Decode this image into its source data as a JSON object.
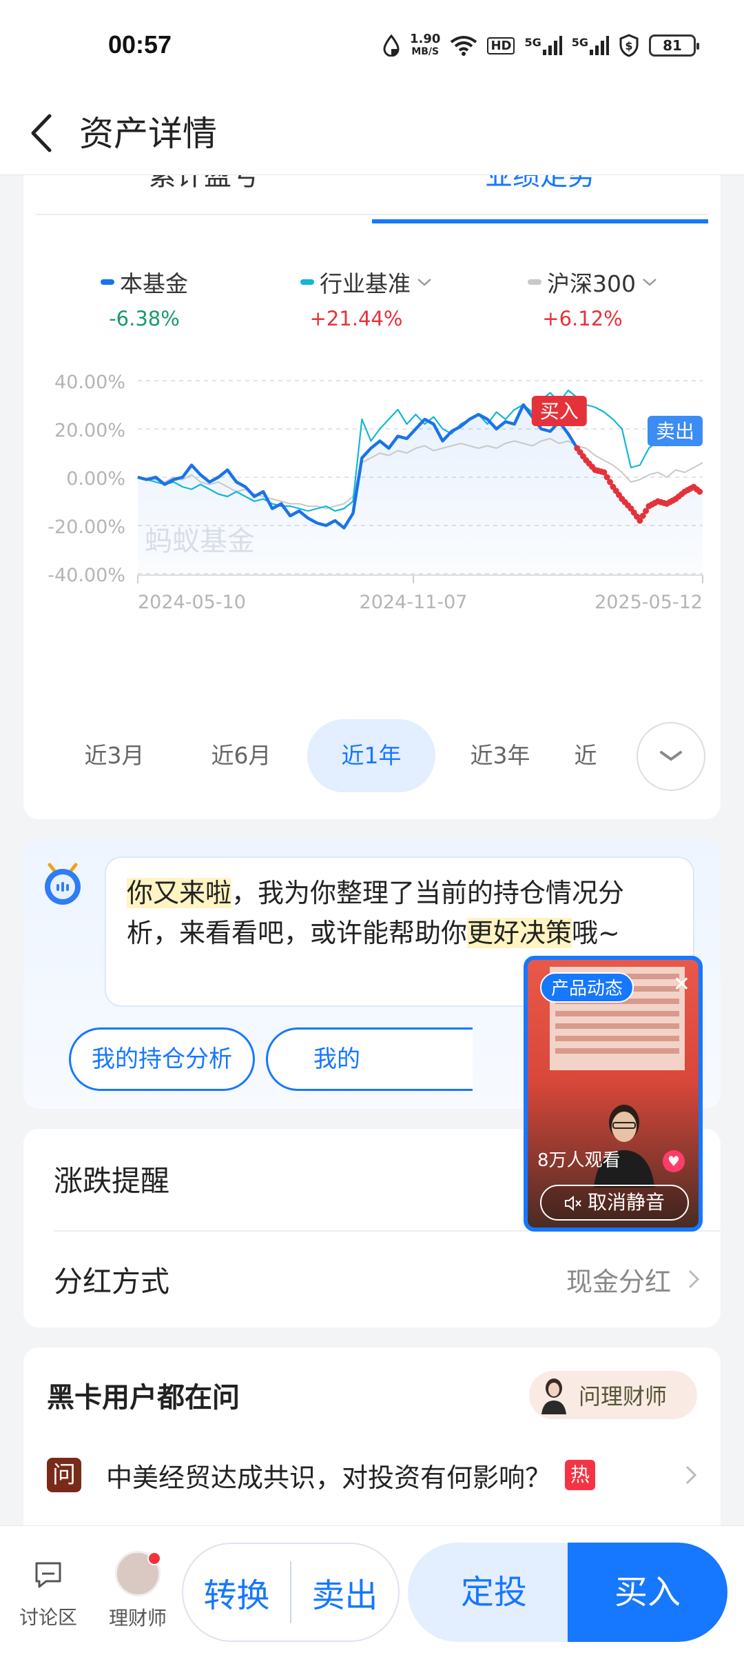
{
  "status_bar": {
    "time": "00:57",
    "net_speed": "1.90",
    "net_unit": "MB/S",
    "hd_label": "HD",
    "sim1": "5G",
    "sim2": "5G",
    "battery": "81"
  },
  "header": {
    "title": "资产详情"
  },
  "tabs": [
    {
      "label": "累计盈亏",
      "active": false
    },
    {
      "label": "业绩走势",
      "active": true
    }
  ],
  "legend": [
    {
      "name": "本基金",
      "value": "-6.38%",
      "color": "#1a73e8",
      "value_color": "#1a9a6a"
    },
    {
      "name": "行业基准",
      "value": "+21.44%",
      "color": "#12b6d6",
      "value_color": "#e5323a"
    },
    {
      "name": "沪深300",
      "value": "+6.12%",
      "color": "#c8c8c8",
      "value_color": "#e5323a"
    }
  ],
  "chart_data": {
    "type": "line",
    "y_ticks": [
      "40.00%",
      "20.00%",
      "0.00%",
      "-20.00%",
      "-40.00%"
    ],
    "ylim": [
      -40,
      40
    ],
    "x_tick_labels": [
      "2024-05-10",
      "2024-11-07",
      "2025-05-12"
    ],
    "watermark": "蚂蚁基金",
    "series": [
      {
        "name": "本基金",
        "color": "#1a73e8",
        "values": [
          0,
          -1,
          0,
          -3,
          -1,
          0,
          5,
          1,
          -2,
          0,
          3,
          -2,
          -4,
          -8,
          -6,
          -13,
          -11,
          -16,
          -14,
          -17,
          -19,
          -20,
          -18,
          -21,
          -15,
          8,
          12,
          15,
          12,
          17,
          16,
          20,
          24,
          22,
          15,
          19,
          21,
          24,
          26,
          24,
          20,
          23,
          22,
          30,
          25,
          20,
          19,
          23,
          18,
          12,
          7,
          3,
          2,
          -4,
          -9,
          -13,
          -18,
          -12,
          -10,
          -11,
          -9,
          -6,
          -4,
          -7
        ]
      },
      {
        "name": "行业基准",
        "color": "#12b6d6",
        "values": [
          0,
          -1,
          -2,
          -3,
          -2,
          -4,
          -5,
          -3,
          -5,
          -7,
          -8,
          -6,
          -8,
          -10,
          -9,
          -11,
          -12,
          -12,
          -13,
          -14,
          -13,
          -12,
          -14,
          -13,
          -10,
          24,
          15,
          20,
          24,
          28,
          22,
          26,
          22,
          25,
          20,
          18,
          22,
          24,
          26,
          22,
          27,
          24,
          28,
          30,
          27,
          32,
          35,
          31,
          36,
          33,
          30,
          29,
          27,
          24,
          20,
          4,
          5,
          12,
          15,
          13,
          17,
          15,
          19,
          21
        ]
      },
      {
        "name": "沪深300",
        "color": "#c8c8c8",
        "values": [
          0,
          -1,
          -1,
          -2,
          0,
          -1,
          1,
          -2,
          -3,
          -2,
          -4,
          -6,
          -5,
          -7,
          -8,
          -9,
          -10,
          -11,
          -11,
          -12,
          -12,
          -13,
          -12,
          -11,
          -8,
          6,
          8,
          10,
          9,
          11,
          10,
          12,
          13,
          11,
          12,
          13,
          14,
          13,
          12,
          13,
          12,
          14,
          15,
          14,
          13,
          15,
          16,
          14,
          15,
          13,
          12,
          9,
          7,
          5,
          2,
          -2,
          -1,
          1,
          2,
          0,
          3,
          2,
          4,
          6
        ]
      }
    ],
    "markers": [
      {
        "label": "买入",
        "color": "#e5323a"
      },
      {
        "label": "卖出",
        "color": "#3b8cf5"
      }
    ]
  },
  "periods": [
    {
      "label": "近3月",
      "active": false
    },
    {
      "label": "近6月",
      "active": false
    },
    {
      "label": "近1年",
      "active": true
    },
    {
      "label": "近3年",
      "active": false
    },
    {
      "label": "近",
      "active": false
    }
  ],
  "ai_card": {
    "message_parts": [
      {
        "text": "你又来啦",
        "highlight": true
      },
      {
        "text": "，我为你整理了当前的持仓情况分析，来看看吧，或许能帮助你",
        "highlight": false
      },
      {
        "text": "更好决策",
        "highlight": true
      },
      {
        "text": "哦~",
        "highlight": false
      }
    ],
    "buttons": [
      "我的持仓分析",
      "我的"
    ]
  },
  "live": {
    "badge": "产品动态",
    "viewers": "8万人观看",
    "mute_label": "取消静音"
  },
  "settings": [
    {
      "label": "涨跌提醒",
      "value": ""
    },
    {
      "label": "分红方式",
      "value": "现金分红"
    }
  ],
  "qa": {
    "title": "黑卡用户都在问",
    "ask_label": "问理财师",
    "item_icon": "问",
    "item_text": "中美经贸达成共识，对投资有何影响？",
    "hot_badge": "热"
  },
  "bottom_bar": {
    "discussion": "讨论区",
    "advisor": "理财师",
    "convert": "转换",
    "sell": "卖出",
    "fixed": "定投",
    "buy": "买入"
  }
}
